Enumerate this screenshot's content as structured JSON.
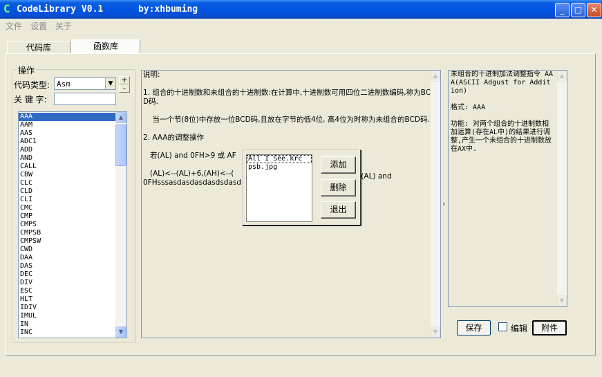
{
  "window": {
    "title": "CodeLibrary V0.1",
    "author": "by:xhbuming",
    "icon_letter": "C",
    "controls": {
      "minimize": "_",
      "maximize": "□",
      "close": "✕"
    }
  },
  "menu": [
    "文件",
    "设置",
    "关于"
  ],
  "tabs": [
    {
      "label": "代码库"
    },
    {
      "label": "函数库",
      "active": true
    }
  ],
  "left": {
    "group_title": "操作",
    "code_type_label": "代码类型:",
    "code_type_value": "Asm",
    "spin_plus": "+",
    "spin_minus": "-",
    "keyword_label": "关 键 字:",
    "keyword_value": "",
    "items": [
      "AAA",
      "AAM",
      "AAS",
      "ADC1",
      "ADD",
      "AND",
      "CALL",
      "CBW",
      "CLC",
      "CLD",
      "CLI",
      "CMC",
      "CMP",
      "CMPS",
      "CMPSB",
      "CMPSW",
      "CWD",
      "DAA",
      "DAS",
      "DEC",
      "DIV",
      "ESC",
      "HLT",
      "IDIV",
      "IMUL",
      "IN",
      "INC"
    ],
    "selected_index": 0
  },
  "description": {
    "lines": [
      "说明:",
      "",
      "1. 组合的十进制数和未组合的十进制数:在计算中,十进制数可用四位二进制数编码,称为BCD码.",
      "",
      "    当一个节(8位)中存放一位BCD码,且放在字节的低4位, 高4位为时称为未组合的BCD码.",
      "",
      "2. AAA的调整操作",
      "",
      "   若(AL) and 0FH>9 或 AF",
      "",
      "   (AL)<--(AL)+6,(AH)<--(",
      "0FHsssasdasdasdasdsdasd"
    ],
    "overflow_fragment": "底-(AL) and"
  },
  "right_panel": {
    "lines": [
      "未组合的十进制加法调整指令 AAA(ASCII Adgust for Addition)",
      "",
      "格式: AAA",
      "",
      "功能: 对两个组合的十进制数相加运算(存在AL中)的结果进行调整,产生一个未组合的十进制数放在AX中."
    ]
  },
  "bottom_buttons": {
    "save": "保存",
    "edit_label": "编辑",
    "edit_checked": false,
    "attach": "附件"
  },
  "attachment_dialog": {
    "files": [
      "All I See.krc",
      "psb.jpg"
    ],
    "add": "添加",
    "delete": "删除",
    "exit": "退出"
  },
  "colors": {
    "titlebar": "#0054e3",
    "selection": "#316ac5",
    "window_bg": "#ece9d8"
  }
}
